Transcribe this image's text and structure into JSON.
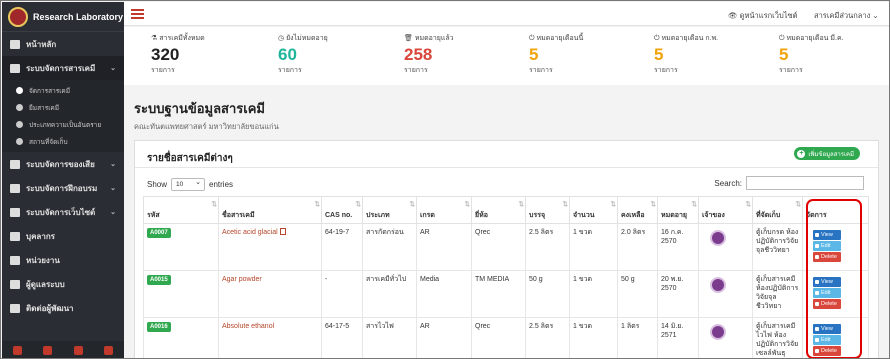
{
  "brand": {
    "name": "Research Laboratory"
  },
  "sidebar": {
    "items": [
      {
        "label": "หน้าหลัก"
      },
      {
        "label": "ระบบจัดการสารเคมี",
        "chevron": "⌄"
      },
      {
        "label": "ระบบจัดการของเสีย",
        "chevron": "⌄"
      },
      {
        "label": "ระบบจัดการฝึกอบรม",
        "chevron": "⌄"
      },
      {
        "label": "ระบบจัดการเว็บไซต์",
        "chevron": "⌄"
      },
      {
        "label": "บุคลากร"
      },
      {
        "label": "หน่วยงาน"
      },
      {
        "label": "ผู้ดูแลระบบ"
      },
      {
        "label": "ติดต่อผู้พัฒนา"
      }
    ],
    "subitems": [
      {
        "label": "จัดการสารเคมี"
      },
      {
        "label": "ยืมสารเคมี"
      },
      {
        "label": "ประเภทความเป็นอันตราย"
      },
      {
        "label": "สถานที่จัดเก็บ"
      }
    ]
  },
  "topbar": {
    "view_site": "ดูหน้าแรกเว็บไซต์",
    "user": "สารเคมีส่วนกลาง"
  },
  "stats": [
    {
      "label": "สารเคมีทั้งหมด",
      "value": "320",
      "unit": "รายการ",
      "color": "#222222",
      "icon": "flask-icon"
    },
    {
      "label": "ยังไม่หมดอายุ",
      "value": "60",
      "unit": "รายการ",
      "color": "#1fb59a",
      "icon": "clock-icon"
    },
    {
      "label": "หมดอายุแล้ว",
      "value": "258",
      "unit": "รายการ",
      "color": "#d9463b",
      "icon": "trash-icon"
    },
    {
      "label": "หมดอายุเดือนนี้",
      "value": "5",
      "unit": "รายการ",
      "color": "#f0a30a",
      "icon": "power-icon"
    },
    {
      "label": "หมดอายุเดือน ก.พ.",
      "value": "5",
      "unit": "รายการ",
      "color": "#f0a30a",
      "icon": "power-icon"
    },
    {
      "label": "หมดอายุเดือน มี.ค.",
      "value": "5",
      "unit": "รายการ",
      "color": "#f0a30a",
      "icon": "power-icon"
    }
  ],
  "page": {
    "title": "ระบบฐานข้อมูลสารเคมี",
    "subtitle": "คณะทันตแพทยศาสตร์ มหาวิทยาลัยขอนแก่น"
  },
  "panel": {
    "title": "รายชื่อสารเคมีต่างๆ",
    "add_button": "เพิ่มข้อมูลสารเคมี",
    "show_label": "Show",
    "show_value": "10",
    "entries_label": "entries",
    "search_label": "Search:"
  },
  "table": {
    "headers": [
      "รหัส",
      "ชื่อสารเคมี",
      "CAS no.",
      "ประเภท",
      "เกรด",
      "ยี่ห้อ",
      "บรรจุ",
      "จำนวน",
      "คงเหลือ",
      "หมดอายุ",
      "เจ้าของ",
      "ที่จัดเก็บ",
      "จัดการ"
    ],
    "rows": [
      {
        "code": "A0007",
        "name": "Acetic acid glacial",
        "cas": "64-19-7",
        "type": "สารกัดกร่อน",
        "grade": "AR",
        "brand": "Qrec",
        "pack": "2.5 ลิตร",
        "qty": "1 ขวด",
        "remain": "2.0 ลิตร",
        "expire": "16 ก.ค. 2570",
        "location": "ตู้เก็บกรด ห้องปฏิบัติการวิจัยจุลชีววิทยา"
      },
      {
        "code": "A0015",
        "name": "Agar powder",
        "cas": "-",
        "type": "สารเคมีทั่วไป",
        "grade": "Media",
        "brand": "TM MEDIA",
        "pack": "50 g",
        "qty": "1 ขวด",
        "remain": "50 g",
        "expire": "20 พ.ย. 2570",
        "location": "ตู้เก็บสารเคมี ห้องปฏิบัติการวิจัยจุลชีววิทยา"
      },
      {
        "code": "A0016",
        "name": "Absolute ethanol",
        "cas": "64-17-5",
        "type": "สารไวไฟ",
        "grade": "AR",
        "brand": "Qrec",
        "pack": "2.5 ลิตร",
        "qty": "1 ขวด",
        "remain": "1 ลิตร",
        "expire": "14 มิ.ย. 2571",
        "location": "ตู้เก็บสารเคมีไวไฟ ห้องปฏิบัติการวิจัยเซลล์พันธุ"
      }
    ],
    "actions": {
      "view": "View",
      "edit": "Edit",
      "delete": "Delete"
    }
  }
}
